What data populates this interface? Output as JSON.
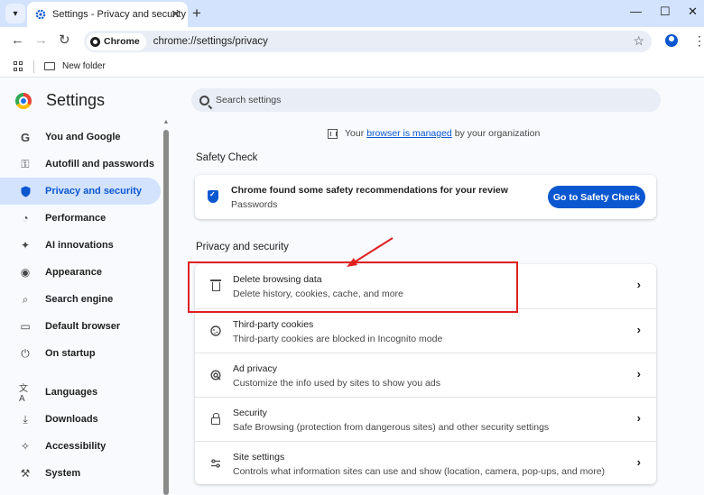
{
  "browser": {
    "tab": {
      "title": "Settings - Privacy and security"
    },
    "omnibox": {
      "chip": "Chrome",
      "url": "chrome://settings/privacy"
    },
    "bookmarks": {
      "folder": "New folder"
    }
  },
  "settings": {
    "title": "Settings",
    "search": {
      "placeholder": "Search settings"
    },
    "sidebar": {
      "items": [
        {
          "label": "You and Google",
          "icon": "google-g-icon"
        },
        {
          "label": "Autofill and passwords",
          "icon": "key-icon"
        },
        {
          "label": "Privacy and security",
          "icon": "shield-icon",
          "active": true
        },
        {
          "label": "Performance",
          "icon": "speedometer-icon"
        },
        {
          "label": "AI innovations",
          "icon": "sparkle-icon"
        },
        {
          "label": "Appearance",
          "icon": "palette-icon"
        },
        {
          "label": "Search engine",
          "icon": "search-icon"
        },
        {
          "label": "Default browser",
          "icon": "browser-window-icon"
        },
        {
          "label": "On startup",
          "icon": "power-icon"
        },
        {
          "label": "Languages",
          "icon": "translate-icon"
        },
        {
          "label": "Downloads",
          "icon": "download-icon"
        },
        {
          "label": "Accessibility",
          "icon": "accessibility-icon"
        },
        {
          "label": "System",
          "icon": "wrench-icon"
        }
      ]
    },
    "managed": {
      "prefix": "Your",
      "link": "browser is managed",
      "suffix": "by your organization"
    },
    "safety_check": {
      "heading": "Safety Check",
      "primary": "Chrome found some safety recommendations for your review",
      "secondary": "Passwords",
      "button": "Go to Safety Check"
    },
    "privacy": {
      "heading": "Privacy and security",
      "rows": [
        {
          "primary": "Delete browsing data",
          "secondary": "Delete history, cookies, cache, and more",
          "icon": "trash-icon"
        },
        {
          "primary": "Third-party cookies",
          "secondary": "Third-party cookies are blocked in Incognito mode",
          "icon": "cookie-icon"
        },
        {
          "primary": "Ad privacy",
          "secondary": "Customize the info used by sites to show you ads",
          "icon": "ad-privacy-icon"
        },
        {
          "primary": "Security",
          "secondary": "Safe Browsing (protection from dangerous sites) and other security settings",
          "icon": "lock-icon"
        },
        {
          "primary": "Site settings",
          "secondary": "Controls what information sites can use and show (location, camera, pop-ups, and more)",
          "icon": "tune-icon"
        }
      ]
    }
  },
  "colors": {
    "accent": "#0b57d0",
    "active_bg": "#d3e3fd",
    "annotation": "#e02020"
  }
}
